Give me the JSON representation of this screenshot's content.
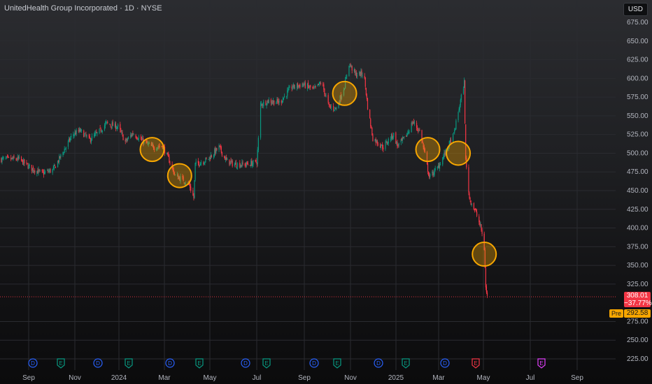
{
  "header": {
    "symbol_title": "UnitedHealth Group Incorporated · 1D · NYSE",
    "currency": "USD"
  },
  "price_scale": {
    "ticks": [
      "675.00",
      "650.00",
      "625.00",
      "600.00",
      "575.00",
      "550.00",
      "525.00",
      "500.00",
      "475.00",
      "450.00",
      "425.00",
      "400.00",
      "375.00",
      "350.00",
      "325.00",
      "275.00",
      "250.00",
      "225.00"
    ],
    "last_price": "308.01",
    "last_change": "−37.77%",
    "pre_tag": "Pre",
    "pre_price": "292.58"
  },
  "time_axis": {
    "labels": [
      "Sep",
      "Nov",
      "2024",
      "Mar",
      "May",
      "Jul",
      "Sep",
      "Nov",
      "2025",
      "Mar",
      "May",
      "Jul",
      "Sep"
    ]
  },
  "event_markers": [
    {
      "type": "D",
      "color": "#2962ff"
    },
    {
      "type": "E",
      "color": "#089981"
    },
    {
      "type": "D",
      "color": "#2962ff"
    },
    {
      "type": "E",
      "color": "#089981"
    },
    {
      "type": "D",
      "color": "#2962ff"
    },
    {
      "type": "E",
      "color": "#089981"
    },
    {
      "type": "D",
      "color": "#2962ff"
    },
    {
      "type": "E",
      "color": "#089981"
    },
    {
      "type": "D",
      "color": "#2962ff"
    },
    {
      "type": "E",
      "color": "#089981"
    },
    {
      "type": "D",
      "color": "#2962ff"
    },
    {
      "type": "E",
      "color": "#089981"
    },
    {
      "type": "D",
      "color": "#2962ff"
    },
    {
      "type": "E",
      "color": "#f23645"
    },
    {
      "type": "E",
      "color": "#e040fb"
    }
  ],
  "colors": {
    "up": "#089981",
    "down": "#f23645",
    "highlight": "#f7a600",
    "axis_text": "#b2b5be",
    "grid": "#2a2b30"
  },
  "chart_data": {
    "type": "candlestick",
    "title": "UnitedHealth Group Incorporated · 1D · NYSE",
    "currency": "USD",
    "y_range": [
      225,
      675
    ],
    "x_range": [
      "2023-08-03",
      "2025-09-30"
    ],
    "last_price": 308.01,
    "change_percent": -37.77,
    "premarket_price": 292.58,
    "price_path": [
      [
        "2023-08-01",
        492
      ],
      [
        "2023-08-25",
        492
      ],
      [
        "2023-09-10",
        480
      ],
      [
        "2023-09-25",
        473
      ],
      [
        "2023-10-10",
        478
      ],
      [
        "2023-10-25",
        505
      ],
      [
        "2023-11-05",
        525
      ],
      [
        "2023-11-15",
        530
      ],
      [
        "2023-11-28",
        518
      ],
      [
        "2023-12-10",
        528
      ],
      [
        "2023-12-20",
        540
      ],
      [
        "2024-01-05",
        535
      ],
      [
        "2024-01-15",
        515
      ],
      [
        "2024-01-25",
        527
      ],
      [
        "2024-02-05",
        518
      ],
      [
        "2024-02-20",
        508
      ],
      [
        "2024-03-05",
        510
      ],
      [
        "2024-03-15",
        488
      ],
      [
        "2024-03-22",
        470
      ],
      [
        "2024-04-01",
        465
      ],
      [
        "2024-04-10",
        458
      ],
      [
        "2024-04-16",
        440
      ],
      [
        "2024-04-18",
        485
      ],
      [
        "2024-05-05",
        492
      ],
      [
        "2024-05-20",
        508
      ],
      [
        "2024-05-30",
        490
      ],
      [
        "2024-06-10",
        485
      ],
      [
        "2024-06-25",
        485
      ],
      [
        "2024-07-10",
        488
      ],
      [
        "2024-07-15",
        565
      ],
      [
        "2024-07-25",
        570
      ],
      [
        "2024-08-10",
        568
      ],
      [
        "2024-08-25",
        588
      ],
      [
        "2024-09-10",
        592
      ],
      [
        "2024-09-25",
        585
      ],
      [
        "2024-10-05",
        595
      ],
      [
        "2024-10-15",
        562
      ],
      [
        "2024-10-25",
        560
      ],
      [
        "2024-11-05",
        590
      ],
      [
        "2024-11-11",
        620
      ],
      [
        "2024-11-20",
        605
      ],
      [
        "2024-12-01",
        607
      ],
      [
        "2024-12-06",
        562
      ],
      [
        "2024-12-13",
        520
      ],
      [
        "2024-12-27",
        508
      ],
      [
        "2025-01-05",
        520
      ],
      [
        "2025-01-10",
        525
      ],
      [
        "2025-01-15",
        510
      ],
      [
        "2025-01-25",
        520
      ],
      [
        "2025-02-05",
        542
      ],
      [
        "2025-02-15",
        528
      ],
      [
        "2025-02-27",
        468
      ],
      [
        "2025-03-10",
        480
      ],
      [
        "2025-03-20",
        500
      ],
      [
        "2025-04-01",
        525
      ],
      [
        "2025-04-08",
        560
      ],
      [
        "2025-04-15",
        595
      ],
      [
        "2025-04-17",
        490
      ],
      [
        "2025-04-22",
        440
      ],
      [
        "2025-05-01",
        420
      ],
      [
        "2025-05-08",
        398
      ],
      [
        "2025-05-12",
        372
      ],
      [
        "2025-05-13",
        348
      ],
      [
        "2025-05-14",
        320
      ],
      [
        "2025-05-16",
        308
      ]
    ],
    "highlighted_events": [
      {
        "date": "2024-02-20",
        "price": 505
      },
      {
        "date": "2024-03-28",
        "price": 470
      },
      {
        "date": "2024-11-05",
        "price": 580
      },
      {
        "date": "2025-02-25",
        "price": 505
      },
      {
        "date": "2025-04-07",
        "price": 500
      },
      {
        "date": "2025-05-12",
        "price": 365
      }
    ]
  }
}
